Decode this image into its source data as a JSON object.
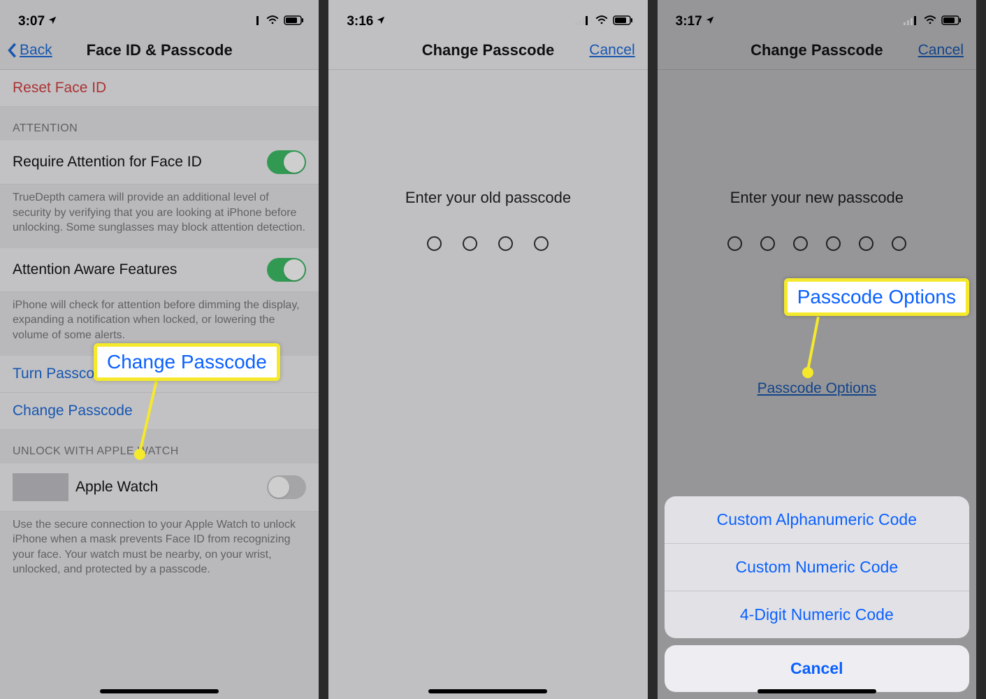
{
  "screen1": {
    "time": "3:07",
    "back_label": "Back",
    "title": "Face ID & Passcode",
    "reset_face_id": "Reset Face ID",
    "attention_header": "ATTENTION",
    "require_attention": "Require Attention for Face ID",
    "require_attention_footer": "TrueDepth camera will provide an additional level of security by verifying that you are looking at iPhone before unlocking. Some sunglasses may block attention detection.",
    "attention_aware": "Attention Aware Features",
    "attention_aware_footer": "iPhone will check for attention before dimming the display, expanding a notification when locked, or lowering the volume of some alerts.",
    "turn_passcode_off": "Turn Passcode Off",
    "change_passcode": "Change Passcode",
    "unlock_watch_header": "UNLOCK WITH APPLE WATCH",
    "apple_watch": "Apple Watch",
    "apple_watch_footer": "Use the secure connection to your Apple Watch to unlock iPhone when a mask prevents Face ID from recognizing your face. Your watch must be nearby, on your wrist, unlocked, and protected by a passcode.",
    "callout_change_passcode": "Change Passcode"
  },
  "screen2": {
    "time": "3:16",
    "title": "Change Passcode",
    "cancel": "Cancel",
    "prompt": "Enter your old passcode",
    "dot_count": 4
  },
  "screen3": {
    "time": "3:17",
    "title": "Change Passcode",
    "cancel": "Cancel",
    "prompt": "Enter your new passcode",
    "dot_count": 6,
    "passcode_options": "Passcode Options",
    "callout_passcode_options": "Passcode Options",
    "sheet": {
      "items": [
        "Custom Alphanumeric Code",
        "Custom Numeric Code",
        "4-Digit Numeric Code"
      ],
      "cancel": "Cancel"
    }
  }
}
